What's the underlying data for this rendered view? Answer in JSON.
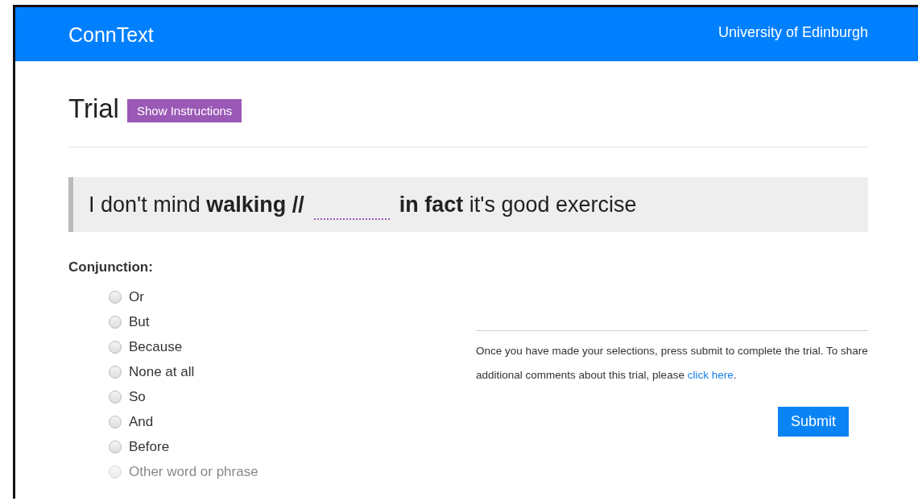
{
  "header": {
    "brand": "ConnText",
    "institution": "University of Edinburgh"
  },
  "page": {
    "title": "Trial",
    "instructions_button": "Show Instructions"
  },
  "sentence": {
    "before": "I don't mind **walking //**",
    "after": "**in fact** it's good exercise"
  },
  "question": {
    "label": "Conjunction:",
    "options": [
      {
        "label": "Or",
        "selected": false,
        "disabled": false
      },
      {
        "label": "But",
        "selected": false,
        "disabled": false
      },
      {
        "label": "Because",
        "selected": false,
        "disabled": false
      },
      {
        "label": "None at all",
        "selected": false,
        "disabled": false
      },
      {
        "label": "So",
        "selected": false,
        "disabled": false
      },
      {
        "label": "And",
        "selected": false,
        "disabled": false
      },
      {
        "label": "Before",
        "selected": false,
        "disabled": false
      },
      {
        "label": "Other word or phrase",
        "selected": false,
        "disabled": true
      }
    ]
  },
  "submit_panel": {
    "note": "Once you have made your selections, press submit to complete the trial. To share additional comments about this trial, please",
    "link": "click here",
    "note_end": ".",
    "button": "Submit"
  }
}
